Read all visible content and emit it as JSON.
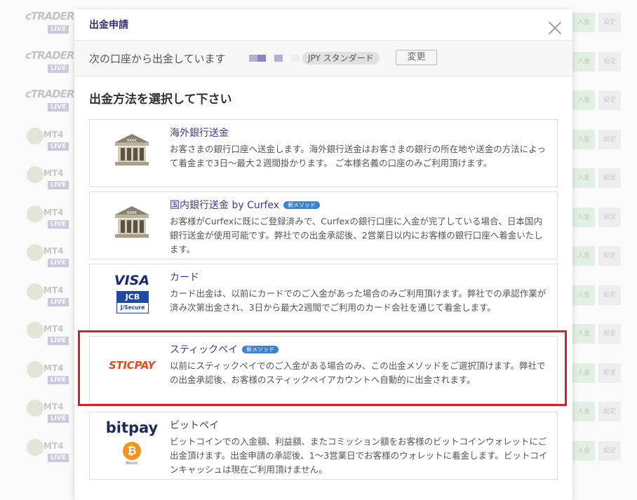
{
  "background": {
    "rows": [
      {
        "brand": "cTRADER",
        "live": "LIVE",
        "deposit": "入金",
        "settings": "設定"
      },
      {
        "brand": "cTRADER",
        "live": "LIVE",
        "deposit": "入金",
        "settings": "設定"
      },
      {
        "brand": "cTRADER",
        "live": "LIVE",
        "deposit": "入金",
        "settings": "設定"
      },
      {
        "brand": "MT4",
        "live": "LIVE",
        "deposit": "入金",
        "settings": "設定"
      },
      {
        "brand": "MT4",
        "live": "LIVE",
        "deposit": "入金",
        "settings": "設定"
      },
      {
        "brand": "MT4",
        "live": "LIVE",
        "deposit": "入金",
        "settings": "設定"
      },
      {
        "brand": "MT4",
        "live": "LIVE",
        "deposit": "入金",
        "settings": "設定"
      },
      {
        "brand": "MT4",
        "live": "LIVE",
        "deposit": "入金",
        "settings": "設定"
      },
      {
        "brand": "MT4",
        "live": "LIVE",
        "deposit": "入金",
        "settings": "設定"
      },
      {
        "brand": "MT4",
        "live": "LIVE",
        "deposit": "入金",
        "settings": "設定"
      },
      {
        "brand": "MT4",
        "live": "LIVE",
        "deposit": "入金",
        "settings": "設定"
      },
      {
        "brand": "MT4",
        "live": "LIVE",
        "deposit": "入金",
        "settings": "設定"
      }
    ]
  },
  "modal": {
    "title": "出金申請",
    "close_icon": "close-icon",
    "account": {
      "prefix": "次の口座から出金しています",
      "currency": "JPY スタンダード",
      "change_label": "変更",
      "mask_colors": [
        "#b7aed6",
        "#8f80bf",
        "#b7aed6",
        "#eeeeee"
      ]
    },
    "section_title": "出金方法を選択して下さい",
    "methods": [
      {
        "name": "海外銀行送金",
        "badge": "",
        "icon": "bank-icon",
        "description": "お客さまの銀行口座へ送金します。海外銀行送金はお客さまの銀行の所在地や送金の方法によって着金まで3日〜最大２週間掛かります。 ご本様名義の口座のみご利用頂けます。"
      },
      {
        "name": "国内銀行送金 by Curfex",
        "badge": "新メソッド",
        "icon": "bank-icon",
        "description": "お客様がCurfexに既にご登録済みで、Curfexの銀行口座に入金が完了している場合、日本国内銀行送金が使用可能です。弊社での出金承認後、2営業日以内にお客様の銀行口座へ着金いたします。"
      },
      {
        "name": "カード",
        "badge": "",
        "icon": "visa-jcb-icon",
        "logo_text": {
          "visa": "VISA",
          "jcb": "JCB",
          "jcb_sub": "J/Secure"
        },
        "description": "カード出金は、以前にカードでのご入金があった場合のみご利用頂けます。弊社での承認作業が済み次第出金され、3日から最大2週間でご利用のカード会社を通じて着金します。"
      },
      {
        "name": "スティックペイ",
        "badge": "新メソッド",
        "icon": "sticpay-icon",
        "logo_text": {
          "sticpay": "STICPAY"
        },
        "description": "以前にスティックペイでのご入金がある場合のみ、この出金メソッドをご選択頂けます。弊社での出金承認後、お客様のスティックペイアカウントへ自動的に出金されます。"
      },
      {
        "name": "ビットペイ",
        "badge": "",
        "icon": "bitpay-icon",
        "logo_text": {
          "bitpay": "bitpay",
          "bitcoin": "Bitcoin"
        },
        "description": "ビットコインでの入金額、利益額、またコミッション額をお客様のビットコインウォレットにご出金頂けます。出金申請の承認後、1〜3営業日でお客様のウォレットに着金します。ビットコインキャッシュは現在ご利用頂けません。"
      }
    ]
  },
  "colors": {
    "accent": "#4a3786",
    "highlight": "#d4202a",
    "badge": "#3b82d6"
  }
}
